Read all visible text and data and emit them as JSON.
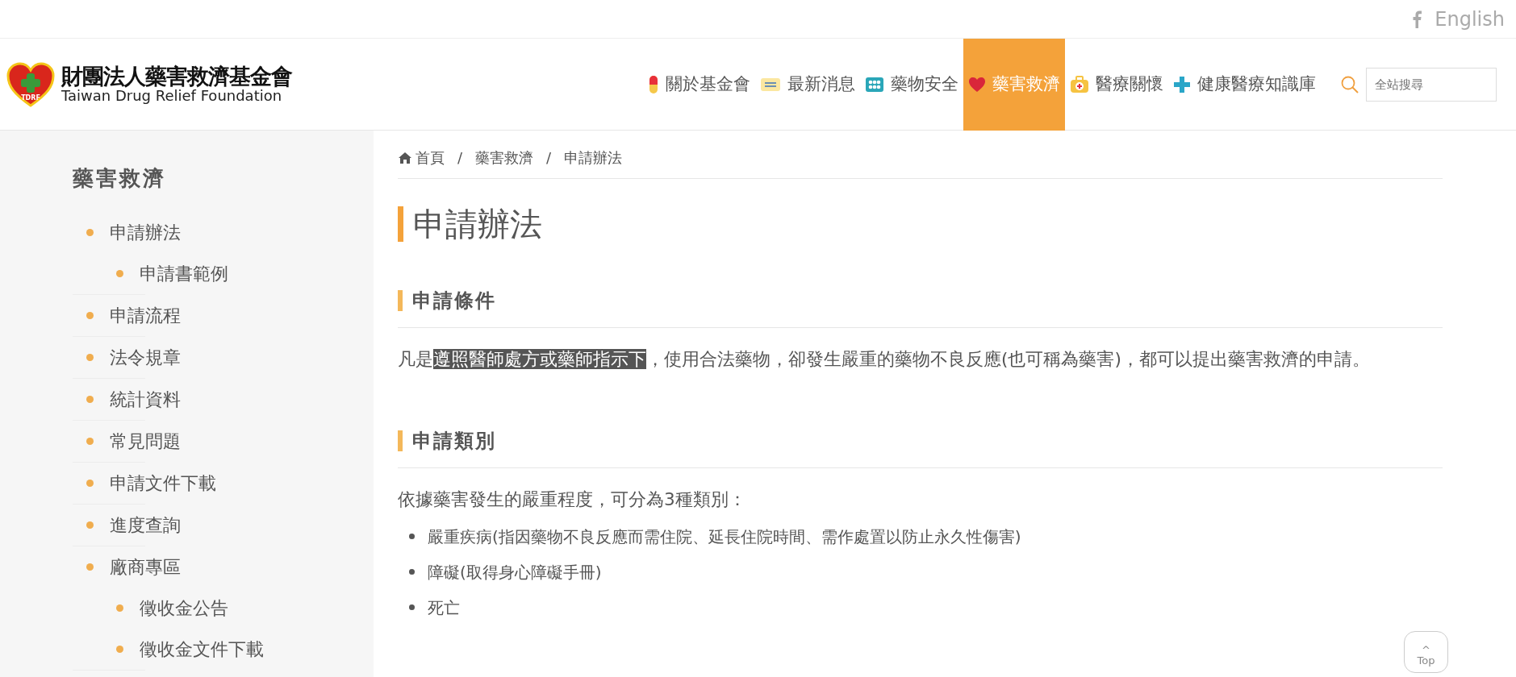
{
  "top_bar": {
    "language_link": "English"
  },
  "header": {
    "logo": {
      "badge": "TDRF",
      "title": "財團法人藥害救濟基金會",
      "subtitle": "Taiwan Drug Relief Foundation"
    },
    "nav": [
      {
        "label": "關於基金會",
        "kind": "capsule",
        "selected": false
      },
      {
        "label": "最新消息",
        "kind": "message",
        "selected": false
      },
      {
        "label": "藥物安全",
        "kind": "blister",
        "selected": false
      },
      {
        "label": "藥害救濟",
        "kind": "heart",
        "selected": true
      },
      {
        "label": "醫療關懷",
        "kind": "medkit",
        "selected": false
      },
      {
        "label": "健康醫療知識庫",
        "kind": "plus",
        "selected": false
      }
    ],
    "search": {
      "placeholder": "全站搜尋"
    }
  },
  "sidebar": {
    "title": "藥害救濟",
    "items": [
      {
        "label": "申請辦法",
        "children": [
          {
            "label": "申請書範例"
          }
        ]
      },
      {
        "label": "申請流程"
      },
      {
        "label": "法令規章"
      },
      {
        "label": "統計資料"
      },
      {
        "label": "常見問題"
      },
      {
        "label": "申請文件下載"
      },
      {
        "label": "進度查詢"
      },
      {
        "label": "廠商專區",
        "children": [
          {
            "label": "徵收金公告"
          },
          {
            "label": "徵收金文件下載"
          }
        ]
      }
    ]
  },
  "breadcrumb": {
    "separator": "/",
    "items": [
      "首頁",
      "藥害救濟",
      "申請辦法"
    ]
  },
  "content": {
    "title": "申請辦法",
    "sections": [
      {
        "heading": "申請條件",
        "paragraph": [
          {
            "text": "凡是",
            "highlighted": false
          },
          {
            "text": "遵照醫師處方或藥師指示下",
            "highlighted": true
          },
          {
            "text": "，使用合法藥物，卻發生嚴重的藥物不良反應(也可稱為藥害)，都可以提出藥害救濟的申請。",
            "highlighted": false
          }
        ]
      },
      {
        "heading": "申請類別",
        "paragraph": [
          {
            "text": "依據藥害發生的嚴重程度，可分為3種類別：",
            "highlighted": false
          }
        ],
        "bullets": [
          "嚴重疾病(指因藥物不良反應而需住院、延長住院時間、需作處置以防止永久性傷害)",
          "障礙(取得身心障礙手冊)",
          "死亡"
        ]
      }
    ]
  },
  "back_to_top": {
    "caret": "^",
    "label": "Top"
  }
}
